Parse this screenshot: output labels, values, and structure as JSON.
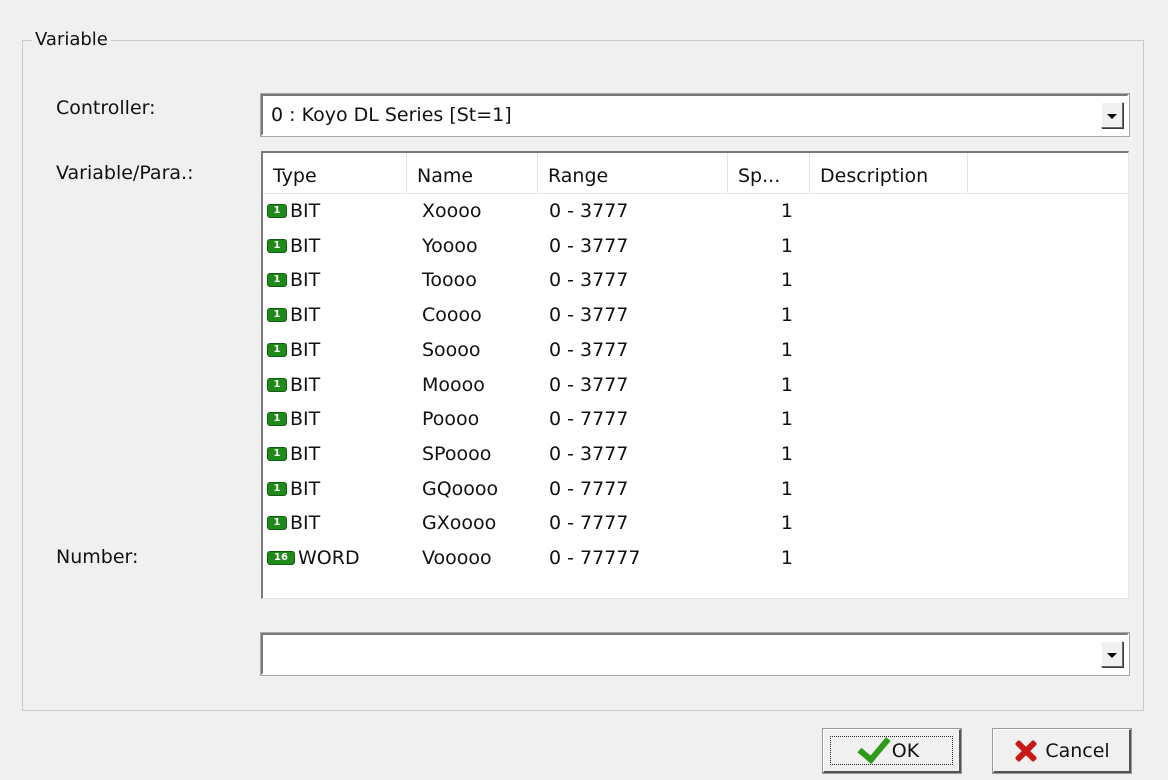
{
  "group": {
    "title": "Variable"
  },
  "labels": {
    "controller": "Controller:",
    "variable_para": "Variable/Para.:",
    "number": "Number:"
  },
  "controller": {
    "value": "0 : Koyo DL Series [St=1]"
  },
  "variable_list": {
    "columns": [
      "Type",
      "Name",
      "Range",
      "Sp...",
      "Description"
    ],
    "rows": [
      {
        "badge": "1",
        "type": "BIT",
        "name": "Xoooo",
        "range": "0 - 3777",
        "sp": "1",
        "description": ""
      },
      {
        "badge": "1",
        "type": "BIT",
        "name": "Yoooo",
        "range": "0 - 3777",
        "sp": "1",
        "description": ""
      },
      {
        "badge": "1",
        "type": "BIT",
        "name": "Toooo",
        "range": "0 - 3777",
        "sp": "1",
        "description": ""
      },
      {
        "badge": "1",
        "type": "BIT",
        "name": "Coooo",
        "range": "0 - 3777",
        "sp": "1",
        "description": ""
      },
      {
        "badge": "1",
        "type": "BIT",
        "name": "Soooo",
        "range": "0 - 3777",
        "sp": "1",
        "description": ""
      },
      {
        "badge": "1",
        "type": "BIT",
        "name": "Moooo",
        "range": "0 - 3777",
        "sp": "1",
        "description": ""
      },
      {
        "badge": "1",
        "type": "BIT",
        "name": "Poooo",
        "range": "0 - 7777",
        "sp": "1",
        "description": ""
      },
      {
        "badge": "1",
        "type": "BIT",
        "name": "SPoooo",
        "range": "0 - 3777",
        "sp": "1",
        "description": ""
      },
      {
        "badge": "1",
        "type": "BIT",
        "name": "GQoooo",
        "range": "0 - 7777",
        "sp": "1",
        "description": ""
      },
      {
        "badge": "1",
        "type": "BIT",
        "name": "GXoooo",
        "range": "0 - 7777",
        "sp": "1",
        "description": ""
      },
      {
        "badge": "16",
        "type": "WORD",
        "name": "Vooooo",
        "range": "0 - 77777",
        "sp": "1",
        "description": ""
      }
    ]
  },
  "number": {
    "value": ""
  },
  "buttons": {
    "ok": "OK",
    "cancel": "Cancel"
  },
  "icons": {
    "controller_dropdown": "chevron-down-icon",
    "number_dropdown": "chevron-down-icon",
    "bit_badge": "bit-type-icon",
    "word_badge": "word-type-icon",
    "ok": "checkmark-icon",
    "cancel": "close-icon"
  },
  "colors": {
    "badge_green": "#1f8a1a",
    "check_green": "#2e9a1c",
    "cancel_red": "#c81818"
  }
}
